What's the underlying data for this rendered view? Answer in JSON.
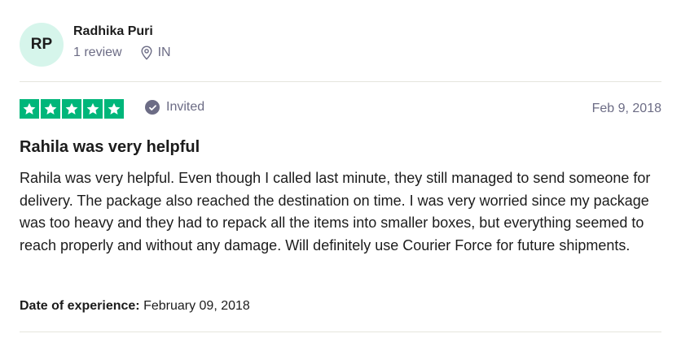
{
  "reviewer": {
    "initials": "RP",
    "name": "Radhika Puri",
    "review_count": "1 review",
    "location": "IN",
    "location_icon": "location-pin-icon"
  },
  "rating": {
    "stars": 5,
    "max_stars": 5,
    "color": "#00b67a"
  },
  "status": {
    "label": "Invited",
    "icon": "check-circle-icon"
  },
  "review": {
    "date": "Feb 9, 2018",
    "title": "Rahila was very helpful",
    "text": "Rahila was very helpful. Even though I called last minute, they still managed to send someone for delivery. The package also reached the destination on time. I was very worried since my package was too heavy and they had to repack all the items into smaller boxes, but everything seemed to reach properly and without any damage. Will definitely use Courier Force for future shipments.",
    "experience_label": "Date of experience:",
    "experience_date": "February 09, 2018"
  }
}
